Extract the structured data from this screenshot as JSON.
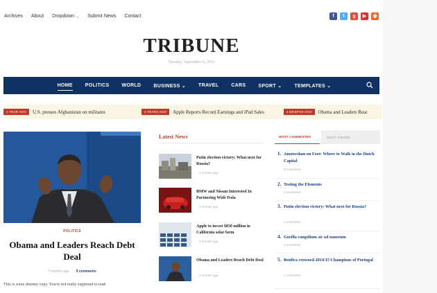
{
  "topbar": {
    "links": [
      "Archives",
      "About",
      "Dropdown",
      "Submit News",
      "Contact"
    ],
    "dropdown_caret": "⌄",
    "socials": [
      {
        "name": "facebook-icon",
        "glyph": "f",
        "color": "#3b5998"
      },
      {
        "name": "twitter-icon",
        "glyph": "t",
        "color": "#55acee"
      },
      {
        "name": "googleplus-icon",
        "glyph": "g",
        "color": "#dd4b39"
      },
      {
        "name": "youtube-icon",
        "glyph": "▶",
        "color": "#e52d27"
      },
      {
        "name": "rss-icon",
        "glyph": "◉",
        "color": "#f26522"
      }
    ]
  },
  "masthead": {
    "logo": "TRIBUNE",
    "date": "Tuesday, September 6, 2016"
  },
  "mainnav": {
    "items": [
      "HOME",
      "POLITICS",
      "WORLD",
      "BUSINESS",
      "TRAVEL",
      "CARS",
      "SPORT",
      "TEMPLATES"
    ],
    "caret": "⌄"
  },
  "ticker": [
    {
      "badge": "1 YEAR AGO",
      "text": "U.S. presses Afghanistan on militants"
    },
    {
      "badge": "2 YEARS AGO",
      "text": "Apple Reports Record Earnings and iPad Sales"
    },
    {
      "badge": "4 MONTHS AGO",
      "text": "Obama and Leaders Reac"
    }
  ],
  "featured": {
    "category": "POLITICS",
    "headline": "Obama and Leaders Reach Debt Deal",
    "ago": "2 months ago",
    "comments": "0 comments",
    "excerpt": "This is some dummy copy. You're not really supposed to read"
  },
  "latest": {
    "title": "Latest News",
    "items": [
      {
        "title": "Putin election victory: What next for Russia?",
        "ago": "3 months ago"
      },
      {
        "title": "BMW and Nissan Interested In Partnering With Tesla",
        "ago": "3 months ago"
      },
      {
        "title": "Apple to invest $850 million in California solar farm",
        "ago": "3 months ago"
      },
      {
        "title": "Obama and Leaders Reach Debt Deal",
        "ago": "3 months ago"
      }
    ]
  },
  "sidebar": {
    "tab_active": "MOST COMMENTED",
    "tab_inactive": "MOST VIEWED",
    "items": [
      {
        "num": "1.",
        "title": "Amsterdam on Foot: Where to Walk in the Dutch Capital",
        "comments": "0 comments"
      },
      {
        "num": "2.",
        "title": "Testing the Elements",
        "comments": "3 comments"
      },
      {
        "num": "3.",
        "title": "Putin election victory: What next for Russia?",
        "comments": "0 comments"
      },
      {
        "num": "4.",
        "title": "Gorilla congolium sic ad nauseum",
        "comments": "3 comments"
      },
      {
        "num": "5.",
        "title": "Benfica crowned 2014/15 Champions of Portugal",
        "comments": "1 comments"
      }
    ]
  }
}
